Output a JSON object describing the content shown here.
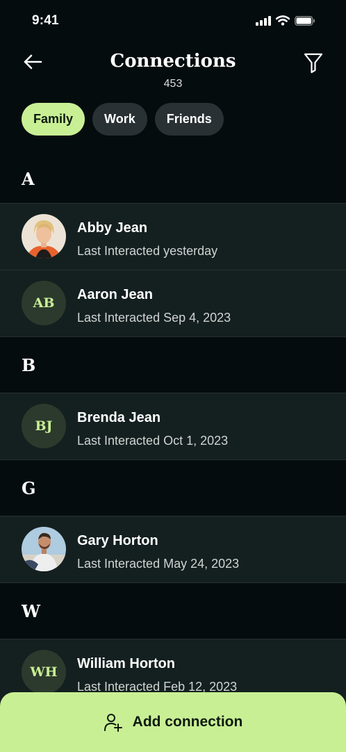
{
  "status_bar": {
    "time": "9:41"
  },
  "header": {
    "title": "Connections",
    "count": "453"
  },
  "tabs": [
    {
      "label": "Family",
      "active": true
    },
    {
      "label": "Work",
      "active": false
    },
    {
      "label": "Friends",
      "active": false
    }
  ],
  "sections": [
    {
      "letter": "A",
      "contacts": [
        {
          "name": "Abby Jean",
          "subtitle": "Last Interacted yesterday",
          "avatar": "photo"
        },
        {
          "name": "Aaron Jean",
          "subtitle": "Last Interacted Sep 4, 2023",
          "avatar": "initials",
          "initials": "AB"
        }
      ]
    },
    {
      "letter": "B",
      "contacts": [
        {
          "name": "Brenda Jean",
          "subtitle": "Last Interacted Oct 1, 2023",
          "avatar": "initials",
          "initials": "BJ"
        }
      ]
    },
    {
      "letter": "G",
      "contacts": [
        {
          "name": "Gary Horton",
          "subtitle": "Last Interacted May 24, 2023",
          "avatar": "photo"
        }
      ]
    },
    {
      "letter": "W",
      "contacts": [
        {
          "name": "William Horton",
          "subtitle": "Last Interacted Feb 12, 2023",
          "avatar": "initials",
          "initials": "WH"
        }
      ]
    }
  ],
  "add_button": {
    "label": "Add connection",
    "icon": "add-user-icon"
  },
  "colors": {
    "accent": "#c9ef95",
    "background": "#050c0e",
    "row": "#14201f",
    "chip": "#2a3134"
  }
}
